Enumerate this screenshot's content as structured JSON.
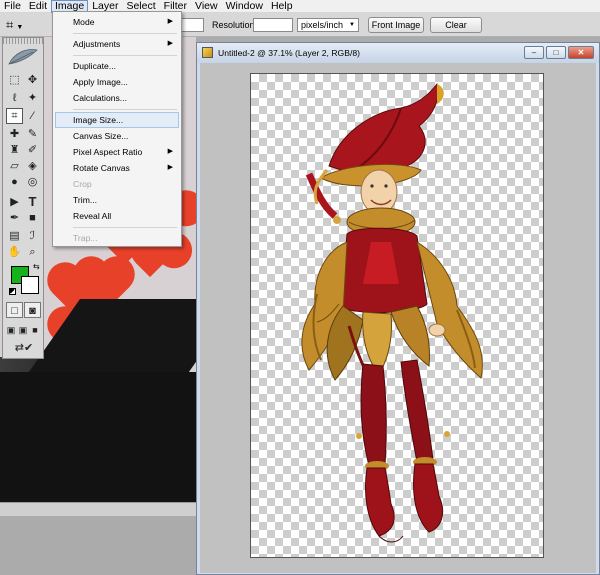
{
  "menubar": {
    "items": [
      "File",
      "Edit",
      "Image",
      "Layer",
      "Select",
      "Filter",
      "View",
      "Window",
      "Help"
    ],
    "active": "Image"
  },
  "options_bar": {
    "tool_icon": "crop-icon",
    "resolution_label": "Resolution:",
    "resolution_value": "",
    "units_value": "pixels/inch",
    "front_image_label": "Front Image",
    "clear_label": "Clear"
  },
  "image_menu": {
    "items": [
      {
        "label": "Mode",
        "submenu": true,
        "enabled": true
      },
      {
        "label": "Adjustments",
        "submenu": true,
        "enabled": true
      },
      {
        "label": "Duplicate...",
        "submenu": false,
        "enabled": true
      },
      {
        "label": "Apply Image...",
        "submenu": false,
        "enabled": true
      },
      {
        "label": "Calculations...",
        "submenu": false,
        "enabled": true
      },
      {
        "label": "Image Size...",
        "submenu": false,
        "enabled": true,
        "highlighted": true
      },
      {
        "label": "Canvas Size...",
        "submenu": false,
        "enabled": true
      },
      {
        "label": "Pixel Aspect Ratio",
        "submenu": true,
        "enabled": true
      },
      {
        "label": "Rotate Canvas",
        "submenu": true,
        "enabled": true
      },
      {
        "label": "Crop",
        "submenu": false,
        "enabled": false
      },
      {
        "label": "Trim...",
        "submenu": false,
        "enabled": true
      },
      {
        "label": "Reveal All",
        "submenu": false,
        "enabled": true
      },
      {
        "label": "Trap...",
        "submenu": false,
        "enabled": false
      }
    ]
  },
  "document": {
    "title": "Untitled-2 @ 37.1% (Layer 2, RGB/8)",
    "window_buttons": [
      "minimize",
      "maximize",
      "close"
    ]
  },
  "toolbox": {
    "foreground_color": "#15b21b",
    "background_color": "#ffffff",
    "tools": [
      "marquee-icon",
      "move-icon",
      "lasso-icon",
      "magic-wand-icon",
      "crop-icon",
      "slice-icon",
      "healing-brush-icon",
      "brush-icon",
      "clone-stamp-icon",
      "history-brush-icon",
      "eraser-icon",
      "paint-bucket-icon",
      "blur-icon",
      "dodge-icon",
      "path-selection-icon",
      "type-icon",
      "pen-icon",
      "shape-icon",
      "notes-icon",
      "eyedropper-icon",
      "hand-icon",
      "zoom-icon"
    ]
  },
  "colors": {
    "menu_highlight": "#e3edf8",
    "document_title_bg": "#d0dced",
    "hearts": "#e8412a"
  }
}
